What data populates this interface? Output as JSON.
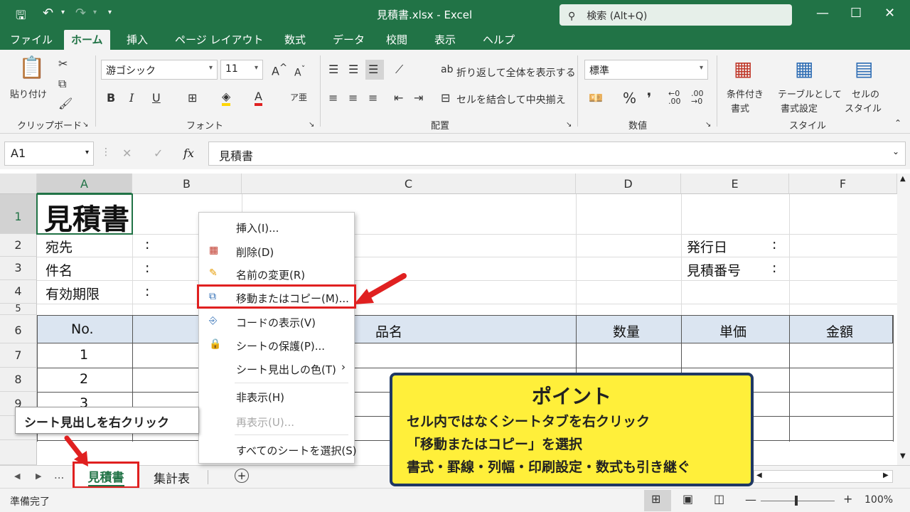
{
  "window": {
    "title": "見積書.xlsx  -  Excel",
    "search_placeholder": "検索 (Alt+Q)"
  },
  "tabs": [
    "ファイル",
    "ホーム",
    "挿入",
    "ページ レイアウト",
    "数式",
    "データ",
    "校閲",
    "表示",
    "ヘルプ"
  ],
  "ribbon": {
    "clipboard": {
      "paste": "貼り付け",
      "label": "クリップボード"
    },
    "font": {
      "name": "游ゴシック",
      "size": "11",
      "bold": "B",
      "italic": "I",
      "underline": "U",
      "label": "フォント"
    },
    "alignment": {
      "wrap": "折り返して全体を表示する",
      "merge": "セルを結合して中央揃え",
      "label": "配置"
    },
    "number": {
      "format": "標準",
      "label": "数値"
    },
    "styles": {
      "conditional": [
        "条件付き",
        "書式"
      ],
      "table": [
        "テーブルとして",
        "書式設定"
      ],
      "cell": [
        "セルの",
        "スタイル"
      ],
      "label": "スタイル"
    }
  },
  "formula_bar": {
    "cell_ref": "A1",
    "fx": "fx",
    "content": "見積書"
  },
  "columns": [
    "A",
    "B",
    "C",
    "D",
    "E",
    "F"
  ],
  "rows": [
    "1",
    "2",
    "3",
    "4",
    "5",
    "6",
    "7",
    "8",
    "9",
    "1"
  ],
  "sheet": {
    "title": "見積書",
    "left_labels": [
      "宛先",
      "件名",
      "有効期限"
    ],
    "colon": ":",
    "right_labels": [
      "発行日",
      "見積番号"
    ],
    "headers": {
      "no": "No.",
      "item": "品名",
      "qty": "数量",
      "price": "単価",
      "amount": "金額"
    },
    "numbers": [
      "1",
      "2",
      "3"
    ]
  },
  "context_menu": {
    "items": [
      "挿入(I)...",
      "削除(D)",
      "名前の変更(R)",
      "移動またはコピー(M)...",
      "コードの表示(V)",
      "シートの保護(P)...",
      "シート見出しの色(T)",
      "非表示(H)",
      "再表示(U)...",
      "すべてのシートを選択(S)"
    ]
  },
  "sheet_tabs": {
    "dots": "...",
    "active": "見積書",
    "other": "集計表",
    "add": "+"
  },
  "status": {
    "ready": "準備完了",
    "zoom": "100%"
  },
  "callouts": {
    "tab_label": "シート見出しを右クリック",
    "point_title": "ポイント",
    "point_lines": [
      "セル内ではなくシートタブを右クリック",
      "「移動またはコピー」を選択",
      "書式・罫線・列幅・印刷設定・数式も引き継ぐ"
    ]
  },
  "colors": {
    "excel_green": "#217346",
    "header_fill": "#dbe5f1",
    "highlight_red": "#e02020",
    "point_yellow": "#ffef3a",
    "point_border": "#1f3864"
  }
}
